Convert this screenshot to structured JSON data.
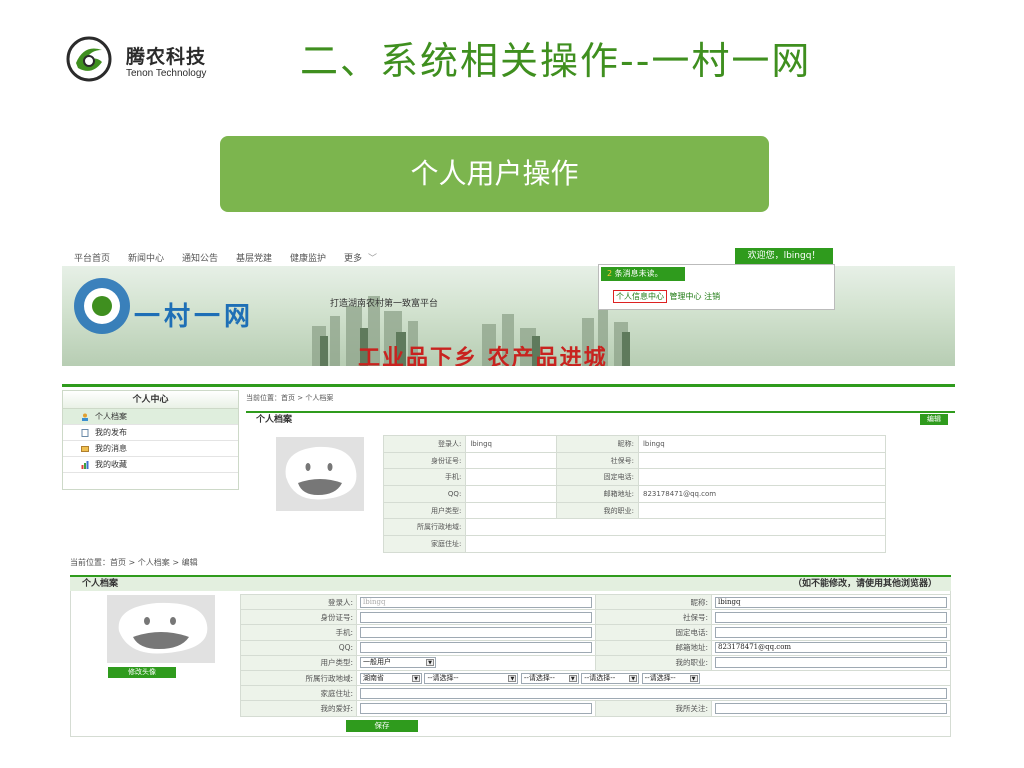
{
  "slide": {
    "logo_cn": "腾农科技",
    "logo_en": "Tenon Technology",
    "title": "二、系统相关操作--一村一网",
    "section_button": "个人用户操作"
  },
  "colors": {
    "brand_green": "#2f9b1d",
    "title_green": "#3f8f1f",
    "section_green": "#7cb54e",
    "highlight_red": "#dd2222"
  },
  "topnav": {
    "items": [
      "平台首页",
      "新闻中心",
      "通知公告",
      "基层党建",
      "健康监护",
      "更多"
    ],
    "more_icon": "chevron-down-icon",
    "welcome": "欢迎您，lbingq！"
  },
  "dropdown": {
    "count": "2",
    "unread": "条消息未读。",
    "links": [
      "个人信息中心",
      "管理中心",
      "注销"
    ]
  },
  "banner": {
    "logo_text": "一村一网",
    "slogan": "打造湖南农村第一致富平台",
    "slogan2": "工业品下乡  农产品进城"
  },
  "sidebar": {
    "title": "个人中心",
    "items": [
      {
        "label": "个人档案",
        "icon": "user-icon"
      },
      {
        "label": "我的发布",
        "icon": "document-icon"
      },
      {
        "label": "我的消息",
        "icon": "message-icon"
      },
      {
        "label": "我的收藏",
        "icon": "chart-icon"
      }
    ]
  },
  "view_panel": {
    "breadcrumb": "当前位置：首页 > 个人档案",
    "title": "个人档案",
    "edit": "编辑",
    "rows": [
      [
        "登录人:",
        "lbingq",
        "昵称:",
        "lbingq"
      ],
      [
        "身份证号:",
        "",
        "社保号:",
        ""
      ],
      [
        "手机:",
        "",
        "固定电话:",
        ""
      ],
      [
        "QQ:",
        "",
        "邮箱地址:",
        "823178471@qq.com"
      ],
      [
        "用户类型:",
        "",
        "我的职业:",
        ""
      ]
    ],
    "row_region": "所属行政地域:",
    "row_address": "家庭住址:"
  },
  "edit_panel": {
    "breadcrumb": "当前位置：首页 > 个人档案 > 编辑",
    "title": "个人档案",
    "note": "（如不能修改，请使用其他浏览器）",
    "change_avatar": "修改头像",
    "labels": {
      "login": "登录人:",
      "nickname": "昵称:",
      "idcard": "身份证号:",
      "social": "社保号:",
      "mobile": "手机:",
      "phone": "固定电话:",
      "qq": "QQ:",
      "email": "邮箱地址:",
      "usertype": "用户类型:",
      "job": "我的职业:",
      "region": "所属行政地域:",
      "address": "家庭住址:",
      "hobby": "我的爱好:",
      "follow": "我所关注:"
    },
    "values": {
      "login": "lbingq",
      "nickname": "lbingq",
      "email": "823178471@qq.com",
      "usertype": "一般用户",
      "province": "湖南省",
      "select_placeholder": "--请选择--",
      "select_placeholder_short": "--请选择--"
    },
    "save": "保存"
  }
}
